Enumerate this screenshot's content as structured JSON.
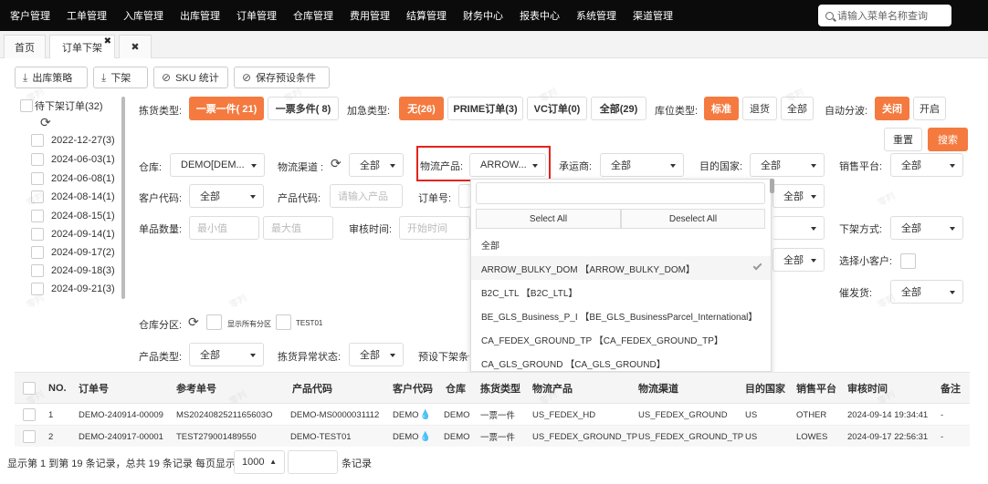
{
  "nav": {
    "items": [
      "客户管理",
      "工单管理",
      "入库管理",
      "出库管理",
      "订单管理",
      "仓库管理",
      "费用管理",
      "结算管理",
      "财务中心",
      "报表中心",
      "系统管理",
      "渠道管理"
    ],
    "search_placeholder": "请输入菜单名称查询"
  },
  "tabs": {
    "home": "首页",
    "current": "订单下架",
    "close": "✖",
    "close_all": "✖"
  },
  "toolbar": {
    "strategy": "出库策略",
    "unshelve": "下架",
    "sku_stats": "SKU 统计",
    "save_preset": "保存预设条件"
  },
  "left_list": {
    "title": "待下架订单(32)",
    "dates": [
      "2022-12-27(3)",
      "2024-06-03(1)",
      "2024-06-08(1)",
      "2024-08-14(1)",
      "2024-08-15(1)",
      "2024-09-14(1)",
      "2024-09-17(2)",
      "2024-09-18(3)",
      "2024-09-21(3)"
    ]
  },
  "filters": {
    "pick_type_label": "拣货类型:",
    "pick_one": "一票一件( 21)",
    "pick_multi": "一票多件( 8)",
    "rush_label": "加急类型:",
    "rush_none": "无(26)",
    "prime": "PRIME订单(3)",
    "vc": "VC订单(0)",
    "all_29": "全部(29)",
    "loc_type_label": "库位类型:",
    "loc_standard": "标准",
    "loc_return": "退货",
    "loc_all": "全部",
    "auto_wave_label": "自动分波:",
    "auto_off": "关闭",
    "auto_on": "开启",
    "reset": "重置",
    "search": "搜索",
    "warehouse_label": "仓库:",
    "warehouse_value": "DEMO[DEM...",
    "channel_label": "物流渠道 :",
    "channel_value": "全部",
    "product_label": "物流产品:",
    "product_value": "ARROW...",
    "carrier_label": "承运商:",
    "carrier_value": "全部",
    "dest_label": "目的国家:",
    "dest_value": "全部",
    "platform_label": "销售平台:",
    "platform_value": "全部",
    "customer_label": "客户代码:",
    "customer_value": "全部",
    "prodcode_label": "产品代码:",
    "prodcode_placeholder": "请输入产品",
    "orderno_label": "订单号:",
    "extra_sel_value": "全部",
    "qty_label": "单品数量:",
    "qty_min": "最小值",
    "qty_max": "最大值",
    "audit_label": "审核时间:",
    "audit_start": "开始时间",
    "unshelve_method_label": "下架方式:",
    "unshelve_method_value": "全部",
    "extra_sel2_value": "全部",
    "small_customer_label": "选择小客户:",
    "urge_label": "催发货:",
    "urge_value": "全部",
    "zone_label": "仓库分区:",
    "show_all_zone": "显示所有分区",
    "zone_test": "TEST01",
    "product_type_label": "产品类型:",
    "product_type_value": "全部",
    "pick_exception_label": "拣货异常状态:",
    "pick_exception_value": "全部",
    "preset_label": "预设下架条件"
  },
  "dropdown": {
    "select_all": "Select All",
    "deselect_all": "Deselect All",
    "options": [
      "全部",
      "ARROW_BULKY_DOM 【ARROW_BULKY_DOM】",
      "B2C_LTL 【B2C_LTL】",
      "BE_GLS_Business_P_I 【BE_GLS_BusinessParcel_International】",
      "CA_FEDEX_GROUND_TP 【CA_FEDEX_GROUND_TP】",
      "CA_GLS_GROUND 【CA_GLS_GROUND】"
    ]
  },
  "table": {
    "headers": [
      "NO.",
      "订单号",
      "参考单号",
      "产品代码",
      "客户代码",
      "仓库",
      "拣货类型",
      "物流产品",
      "物流渠道",
      "目的国家",
      "销售平台",
      "审核时间",
      "备注"
    ],
    "rows": [
      [
        "1",
        "DEMO-240914-00009",
        "MS2024082521165603O",
        "DEMO-MS0000031112",
        "DEMO",
        "DEMO",
        "一票一件",
        "US_FEDEX_HD",
        "US_FEDEX_GROUND",
        "US",
        "OTHER",
        "2024-09-14 19:34:41",
        "-"
      ],
      [
        "2",
        "DEMO-240917-00001",
        "TEST279001489550",
        "DEMO-TEST01",
        "DEMO",
        "DEMO",
        "一票一件",
        "US_FEDEX_GROUND_TP",
        "US_FEDEX_GROUND_TP",
        "US",
        "LOWES",
        "2024-09-17 22:56:31",
        "-"
      ]
    ]
  },
  "footer": {
    "summary": "显示第 1 到第 19 条记录，总共 19 条记录 每页显示",
    "page_size": "1000",
    "records_suffix": "条记录"
  },
  "watermark": "零判",
  "colors": {
    "accent": "#f47a3f",
    "highlight": "#e3241b",
    "nav_bg": "#0b0b0b"
  }
}
